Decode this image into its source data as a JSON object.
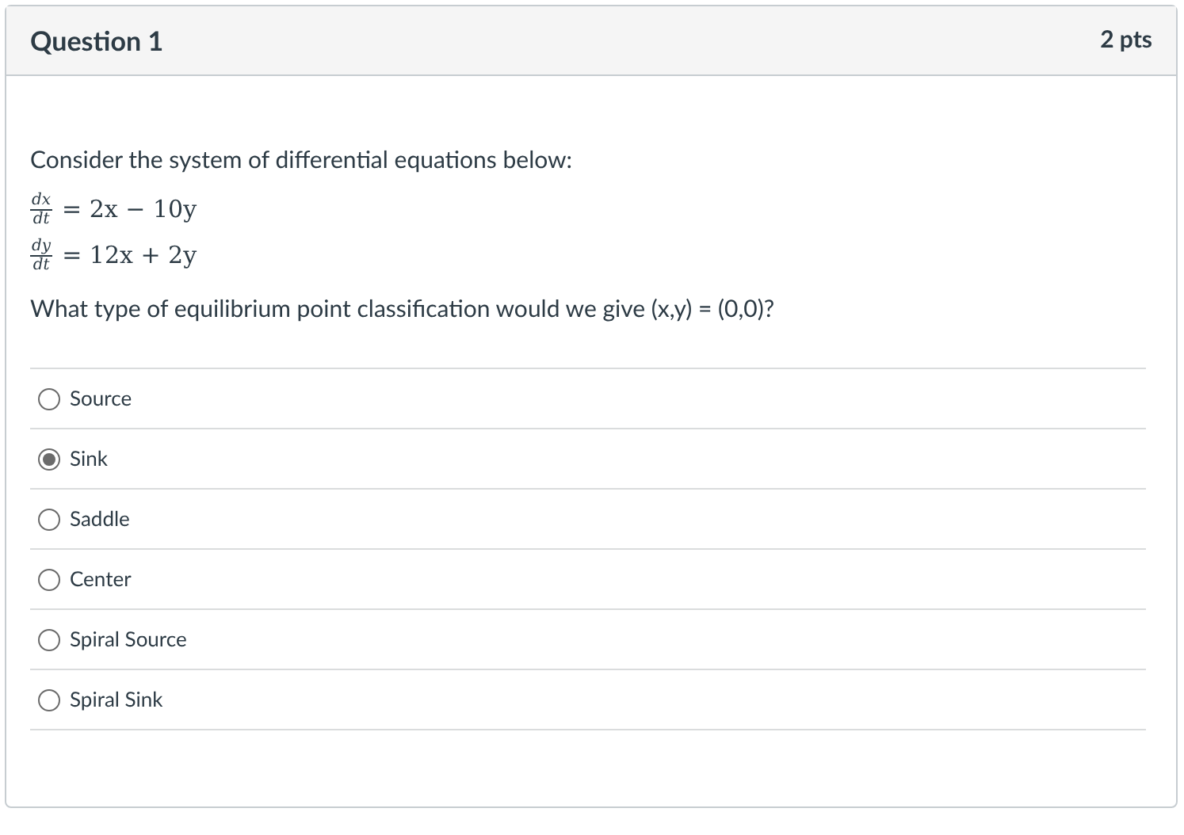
{
  "question": {
    "title": "Question 1",
    "points": "2 pts"
  },
  "intro": "Consider the system of differential equations below:",
  "equations": [
    {
      "numerator": "dx",
      "denominator": "dt",
      "rhs": "= 2x − 10y"
    },
    {
      "numerator": "dy",
      "denominator": "dt",
      "rhs": "= 12x + 2y"
    }
  ],
  "prompt": "What type of equilibrium point classification would we give (x,y) = (0,0)?",
  "answers": [
    {
      "label": "Source",
      "selected": false
    },
    {
      "label": "Sink",
      "selected": true
    },
    {
      "label": "Saddle",
      "selected": false
    },
    {
      "label": "Center",
      "selected": false
    },
    {
      "label": "Spiral Source",
      "selected": false
    },
    {
      "label": "Spiral Sink",
      "selected": false
    }
  ]
}
